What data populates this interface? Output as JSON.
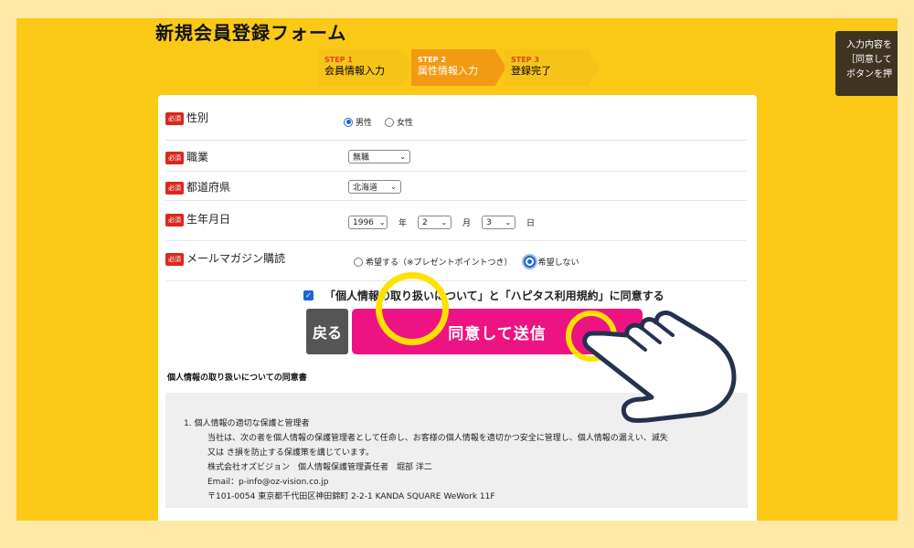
{
  "page_title": "新規会員登録フォーム",
  "steps": [
    {
      "num": "STEP 1",
      "label": "会員情報入力"
    },
    {
      "num": "STEP 2",
      "label": "属性情報入力"
    },
    {
      "num": "STEP 3",
      "label": "登録完了"
    }
  ],
  "tooltip": {
    "line1": "入力内容を",
    "line2": "［同意して",
    "line3": "ボタンを押"
  },
  "required_badge": "必須",
  "fields": {
    "gender": {
      "label": "性別",
      "options": [
        "男性",
        "女性"
      ],
      "selected": "男性"
    },
    "occupation": {
      "label": "職業",
      "value": "無職"
    },
    "prefecture": {
      "label": "都道府県",
      "value": "北海道"
    },
    "birthdate": {
      "label": "生年月日",
      "year": "1996",
      "year_unit": "年",
      "month": "2",
      "month_unit": "月",
      "day": "3",
      "day_unit": "日"
    },
    "newsletter": {
      "label": "メールマガジン購読",
      "options": [
        "希望する（※プレゼントポイントつき）",
        "希望しない"
      ],
      "selected": "希望しない"
    }
  },
  "agree_text": "「個人情報の取り扱いについて」と「ハピタス利用規約」に同意する",
  "back_label": "戻る",
  "submit_label": "同意して送信",
  "privacy": {
    "title": "個人情報の取り扱いについての同意書",
    "heading": "1. 個人情報の適切な保護と管理者",
    "line1": "当社は、次の者を個人情報の保護管理者として任命し、お客様の個人情報を適切かつ安全に管理し、個人情報の漏えい、滅失",
    "line2": "又は き損を防止する保護策を講じています。",
    "line3": "株式会社オズビジョン　個人情報保護管理責任者　堀部 洋二",
    "line4": "Email：p-info@oz-vision.co.jp",
    "line5": "〒101-0054 東京都千代田区神田錦町 2-2-1 KANDA SQUARE WeWork 11F"
  },
  "colors": {
    "background": "#fbc916",
    "submit": "#ee1383",
    "highlight": "#ffe100",
    "required": "#d9281d"
  },
  "icons": [
    "pointing-hand-icon",
    "check-icon",
    "chevron-down-icon"
  ]
}
